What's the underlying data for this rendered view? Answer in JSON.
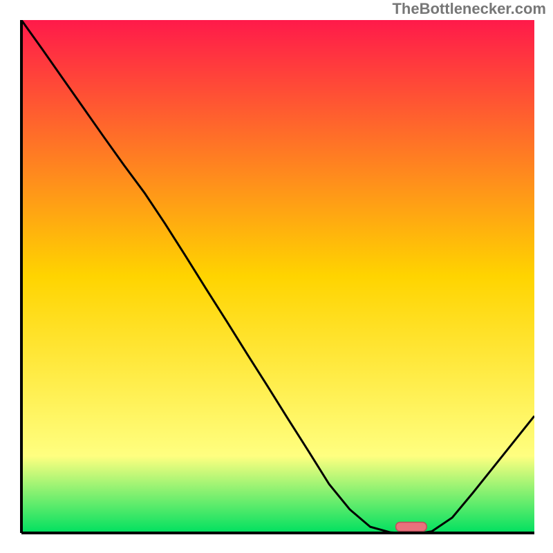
{
  "attribution": "TheBottlenecker.com",
  "chart_data": {
    "type": "line",
    "title": "",
    "xlabel": "",
    "ylabel": "",
    "x": [
      0.0,
      0.04,
      0.08,
      0.12,
      0.16,
      0.2,
      0.24,
      0.28,
      0.32,
      0.36,
      0.4,
      0.44,
      0.48,
      0.52,
      0.56,
      0.6,
      0.64,
      0.68,
      0.72,
      0.74,
      0.76,
      0.78,
      0.8,
      0.84,
      0.88,
      0.92,
      0.96,
      1.0
    ],
    "values": [
      1.0,
      0.944,
      0.887,
      0.83,
      0.773,
      0.717,
      0.663,
      0.603,
      0.54,
      0.476,
      0.413,
      0.349,
      0.286,
      0.222,
      0.159,
      0.095,
      0.046,
      0.012,
      0.001,
      0.0,
      0.0,
      0.0,
      0.003,
      0.03,
      0.078,
      0.128,
      0.178,
      0.228
    ],
    "xlim": [
      0,
      1
    ],
    "ylim": [
      0,
      1
    ],
    "marker": {
      "x": 0.76,
      "width": 0.06
    },
    "colors": {
      "gradient_top": "#ff1a4a",
      "gradient_mid": "#ffd400",
      "gradient_low": "#ffff80",
      "gradient_bottom": "#00e060",
      "line": "#000000",
      "axis": "#000000",
      "marker_fill": "#e8717c",
      "marker_stroke": "#c24a5a"
    }
  }
}
